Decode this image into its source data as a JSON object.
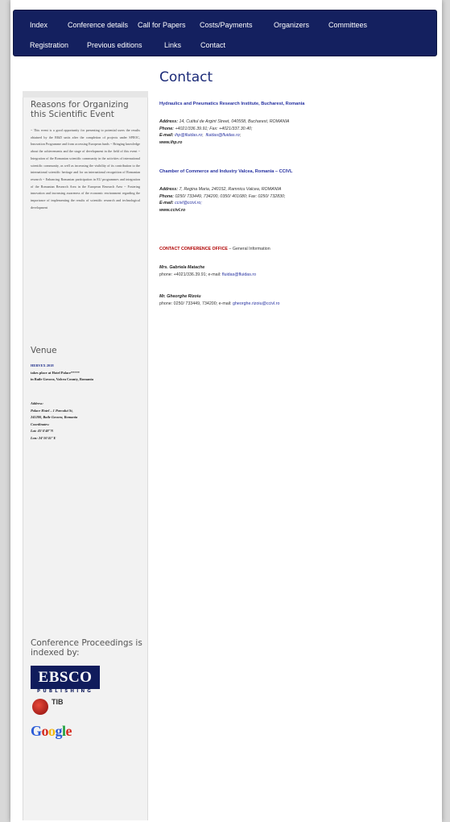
{
  "nav": {
    "row1": [
      "Index",
      "Conference details",
      "Call for Papers",
      "Costs/Payments",
      "Organizers",
      "Committees"
    ],
    "row2": [
      "Registration",
      "Previous editions",
      "Links",
      "Contact"
    ]
  },
  "page_title": "Contact",
  "sidebar": {
    "reasons_heading": "Reasons for Organizing this Scientific Event",
    "reasons_text": "~ This event is a good opportunity for presenting to potential users the results obtained by the R&D units after the completion of projects under SPEOC, Innovation Programme and from accessing European funds ~ Bringing knowledge about the achievements and the stage of development in the field of this event ~ Integration of the Romanian scientific community in the activities of international scientific community, as well as increasing the visibility of its contribution to the international scientific heritage and for an international recognition of Romanian research ~ Enhancing Romanian participation in EU programmes and integration of the Romanian Research Area in the European Research Area ~ Fostering innovation and increasing awareness of the economic environment regarding the importance of implementing the results of scientific research and technological development",
    "venue_heading": "Venue",
    "venue_event": "HERVEX 2018",
    "venue_line1": "takes place at Hotel Palace*****",
    "venue_line2": "in Baile Govora, Valcea County, Romania",
    "address_label": "Address:",
    "address_line1": "Palace Hotel – 1 Parcului St,",
    "address_line2": "245200, Baile Govora, Romania",
    "coord_label": "Coordinates:",
    "lat": "Lat: 45°4'48\"N",
    "lon": "Lon: 24°10'41\"E",
    "indexed_heading": "Conference Proceedings is indexed by:",
    "ebsco": "EBSCO",
    "ebsco_sub": "PUBLISHING",
    "tib": "TIB",
    "google": [
      "G",
      "o",
      "o",
      "g",
      "l",
      "e"
    ]
  },
  "main": {
    "org1_title": "Hydraulics and Pneumatics Research Institute, Bucharest, Romania",
    "org1_address_label": "Address:",
    "org1_address": "14, Cutitul de Argint Street, 040558, Bucharest, ROMANIA",
    "org1_phone_label": "Phone:",
    "org1_phone": "+4021/336.39.91; Fax: +4021/337.30.40;",
    "org1_email_label": "E-mail:",
    "org1_email1": "ihp@fluidas.ro",
    "org1_email2": "fluidas@fluidas.ro",
    "org1_web": "www.ihp.ro",
    "org2_title": "Chamber of Commerce and Industry Valcea, Romania – CCIVL",
    "org2_address_label": "Address:",
    "org2_address": "7, Regina Maria, 240152, Ramnicu Valcea, ROMANIA",
    "org2_phone_label": "Phone:",
    "org2_phone": "0250/ 733449, 734200, 0350/ 401680; Fax: 0250/ 732830;",
    "org2_email_label": "E-mail:",
    "org2_email": "ccivl@ccivl.ro;",
    "org2_web": "www.ccivl.ro",
    "office_title": "CONTACT CONFERENCE OFFICE",
    "office_suffix": " – General Information",
    "person1_name": "Mrs. Gabriela Matache",
    "person1_phone_prefix": "phone: +4021/336.39.91; e-mail: ",
    "person1_email": "fluidas@fluidas.ro",
    "person2_name": "Mr. Gheorghe Rizoiu",
    "person2_phone_prefix": "phone: 0250/ 733449, 734200; e-mail: ",
    "person2_email": "gheorghe.rizoiu@ccivl.ro"
  }
}
